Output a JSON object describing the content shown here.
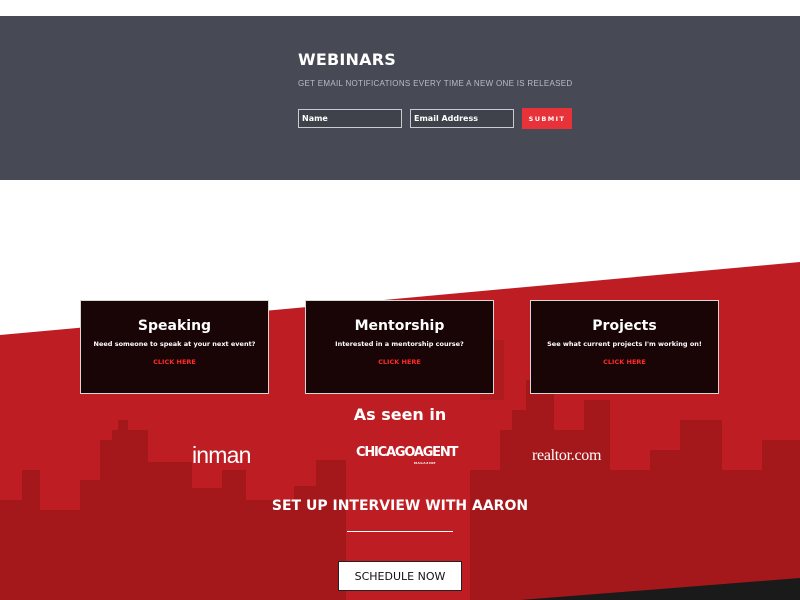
{
  "colors": {
    "webinar_bg": "#474a54",
    "accent_red": "#e8323a",
    "section_red": "#be1e23",
    "card_bg": "#1a0506"
  },
  "webinar": {
    "title": "WEBINARS",
    "subtitle": "GET EMAIL NOTIFICATIONS EVERY TIME A NEW ONE IS RELEASED",
    "name_placeholder": "Name",
    "email_placeholder": "Email Address",
    "submit_label": "SUBMIT"
  },
  "cards": [
    {
      "title": "Speaking",
      "description": "Need someone to speak at your next event?",
      "link": "CLICK HERE"
    },
    {
      "title": "Mentorship",
      "description": "Interested in a mentorship course?",
      "link": "CLICK HERE"
    },
    {
      "title": "Projects",
      "description": "See what current projects I'm working on!",
      "link": "CLICK HERE"
    }
  ],
  "seen_in": {
    "title": "As seen in",
    "logos": {
      "inman": "inman",
      "chicago": "CHICAGOAGENT",
      "chicago_sub": "MAGAZINE",
      "realtor": "realtor.com"
    }
  },
  "interview": {
    "title": "SET UP INTERVIEW WITH AARON",
    "button_label": "SCHEDULE NOW"
  }
}
